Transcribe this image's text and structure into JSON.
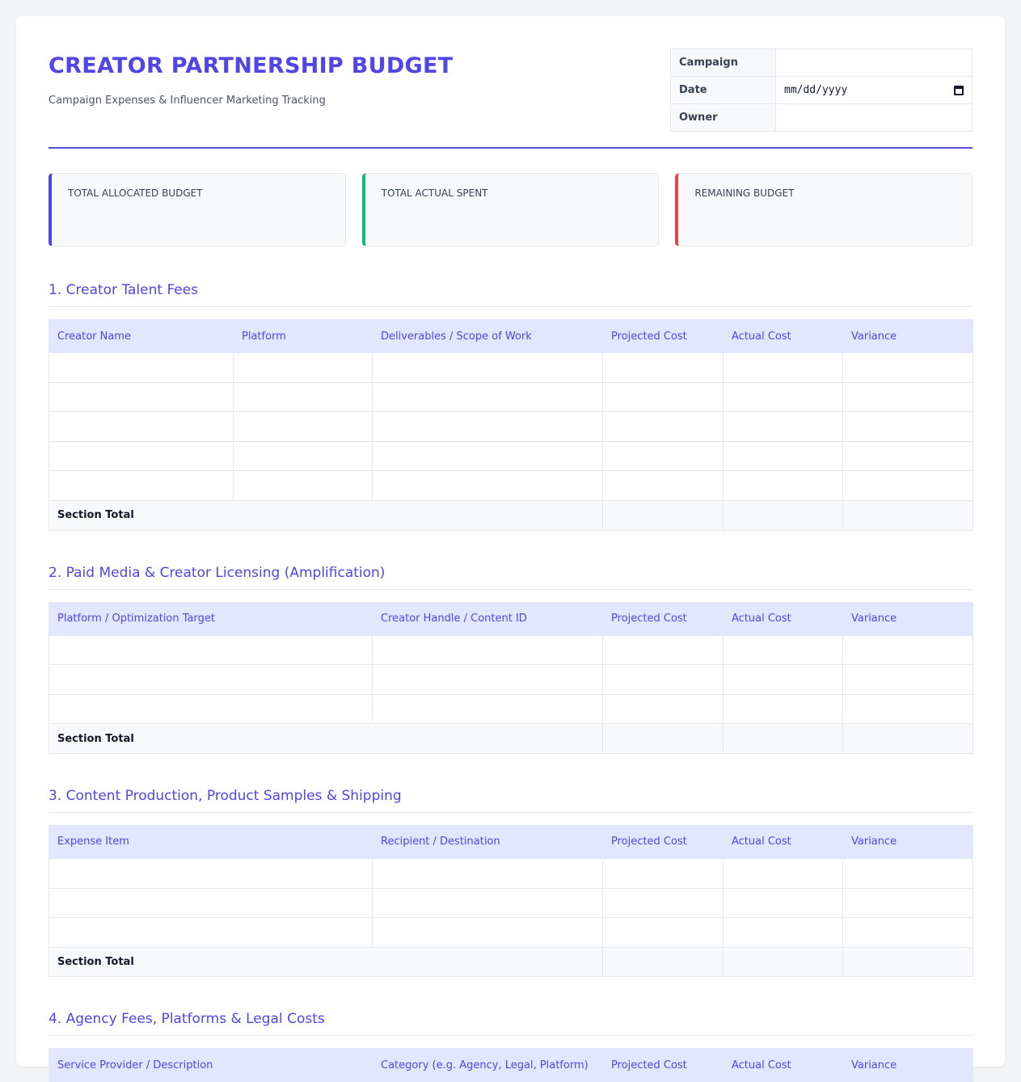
{
  "header": {
    "title": "CREATOR PARTNERSHIP BUDGET",
    "subtitle": "Campaign Expenses & Influencer Marketing Tracking",
    "meta": {
      "campaign_label": "Campaign",
      "date_label": "Date",
      "date_placeholder": "mm/dd/yyyy",
      "owner_label": "Owner"
    }
  },
  "summary": {
    "allocated": "TOTAL ALLOCATED BUDGET",
    "spent": "TOTAL ACTUAL SPENT",
    "remaining": "REMAINING BUDGET"
  },
  "colors": {
    "accent": "#4f46e5",
    "green": "#10b981",
    "red": "#ef4444",
    "header_bg": "#e0e7ff"
  },
  "icons": {
    "date": "calendar-icon"
  },
  "total_label": "Section Total",
  "sections": [
    {
      "title": "1. Creator Talent Fees",
      "columns": [
        "Creator Name",
        "Platform",
        "Deliverables / Scope of Work",
        "Projected Cost",
        "Actual Cost",
        "Variance"
      ]
    },
    {
      "title": "2. Paid Media & Creator Licensing (Amplification)",
      "columns": [
        "Platform / Optimization Target",
        "Creator Handle / Content ID",
        "Projected Cost",
        "Actual Cost",
        "Variance"
      ]
    },
    {
      "title": "3. Content Production, Product Samples & Shipping",
      "columns": [
        "Expense Item",
        "Recipient / Destination",
        "Projected Cost",
        "Actual Cost",
        "Variance"
      ]
    },
    {
      "title": "4. Agency Fees, Platforms & Legal Costs",
      "columns": [
        "Service Provider / Description",
        "Category (e.g. Agency, Legal, Platform)",
        "Projected Cost",
        "Actual Cost",
        "Variance"
      ]
    }
  ]
}
